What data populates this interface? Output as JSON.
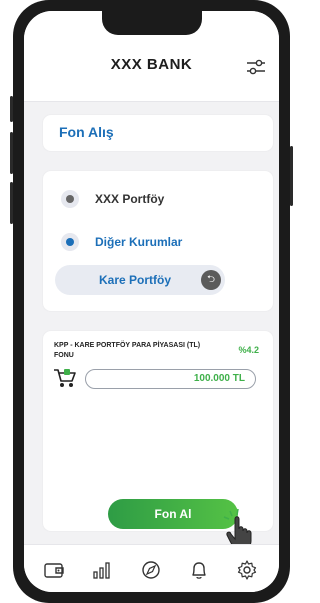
{
  "header": {
    "title": "XXX BANK",
    "settings_icon": "sliders-icon"
  },
  "page": {
    "title": "Fon Alış"
  },
  "source_options": [
    {
      "label": "XXX Portföy",
      "selected": false
    },
    {
      "label": "Diğer Kurumlar",
      "selected": true
    }
  ],
  "institution": {
    "label": "Kare Portföy",
    "icon": "arrow-circle-icon"
  },
  "fund": {
    "name": "KPP - KARE PORTFÖY PARA PİYASASI (TL) FONU",
    "rate": "%4.2",
    "amount": "100.000 TL",
    "icon": "cart-icon"
  },
  "action": {
    "buy_label": "Fon Al"
  },
  "tabbar": [
    "wallet-icon",
    "chart-icon",
    "compass-icon",
    "bell-icon",
    "gear-icon"
  ],
  "colors": {
    "accent_blue": "#1c6fb8",
    "green": "#3fb04a",
    "selected_radio": "#1c6fb8",
    "unselected_radio": "#666666"
  }
}
